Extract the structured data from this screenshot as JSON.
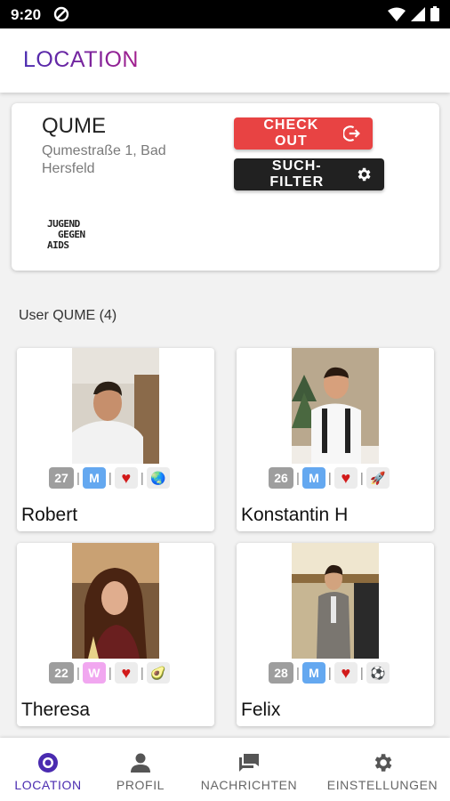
{
  "status_bar": {
    "time": "9:20"
  },
  "app_bar": {
    "title": "LOCATION"
  },
  "location": {
    "name": "QUME",
    "address": "Qumestraße 1, Bad Hersfeld",
    "logo_lines": [
      "JUGEND",
      "GEGEN",
      "AIDS"
    ],
    "checkout_label": "CHECK OUT",
    "filter_label": "SUCH-FILTER"
  },
  "users_section": {
    "title": "User QUME (4)"
  },
  "users": [
    {
      "name": "Robert",
      "age": "27",
      "gender": "M",
      "heart": "♥",
      "hobby": "🌏"
    },
    {
      "name": "Konstantin H",
      "age": "26",
      "gender": "M",
      "heart": "♥",
      "hobby": "🚀"
    },
    {
      "name": "Theresa",
      "age": "22",
      "gender": "W",
      "heart": "♥",
      "hobby": "🥑"
    },
    {
      "name": "Felix",
      "age": "28",
      "gender": "M",
      "heart": "♥",
      "hobby": "⚽"
    }
  ],
  "bottom_nav": {
    "items": [
      {
        "label": "LOCATION",
        "icon": "location-target-icon",
        "active": true
      },
      {
        "label": "PROFIL",
        "icon": "person-icon",
        "active": false
      },
      {
        "label": "NACHRICHTEN",
        "icon": "chat-icon",
        "active": false
      },
      {
        "label": "EINSTELLUNGEN",
        "icon": "gear-icon",
        "active": false
      }
    ]
  },
  "colors": {
    "accent": "#4a2bb0",
    "checkout": "#e84343",
    "filter": "#212121",
    "male_badge": "#64a8f0",
    "female_badge": "#f1a7f0",
    "heart": "#d21a1a"
  }
}
